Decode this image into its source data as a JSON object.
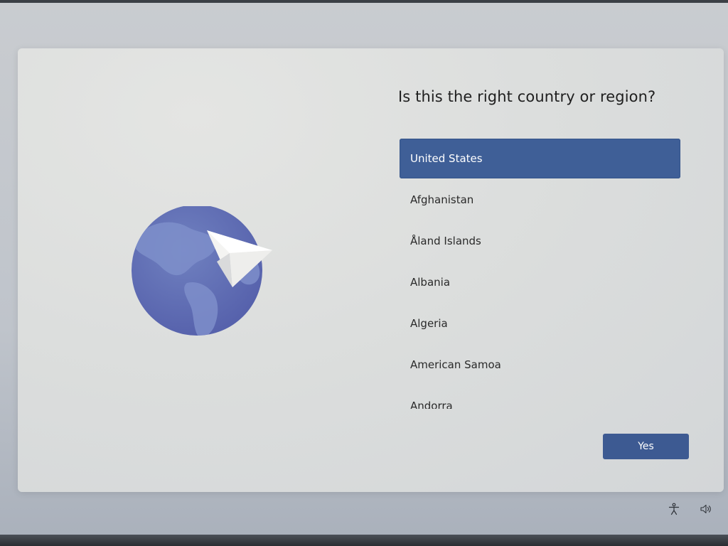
{
  "heading": "Is this the right country or region?",
  "countries": [
    {
      "label": "United States",
      "selected": true
    },
    {
      "label": "Afghanistan",
      "selected": false
    },
    {
      "label": "Åland Islands",
      "selected": false
    },
    {
      "label": "Albania",
      "selected": false
    },
    {
      "label": "Algeria",
      "selected": false
    },
    {
      "label": "American Samoa",
      "selected": false
    },
    {
      "label": "Andorra",
      "selected": false
    }
  ],
  "yes_button": {
    "label": "Yes"
  },
  "illustration": {
    "icon": "globe-paper-plane-icon"
  },
  "system_tray": {
    "icons": [
      "accessibility-icon",
      "volume-icon"
    ]
  },
  "colors": {
    "accent": "#3d5a92",
    "globe": "#6270b4",
    "card_background": "#dcdedd"
  }
}
